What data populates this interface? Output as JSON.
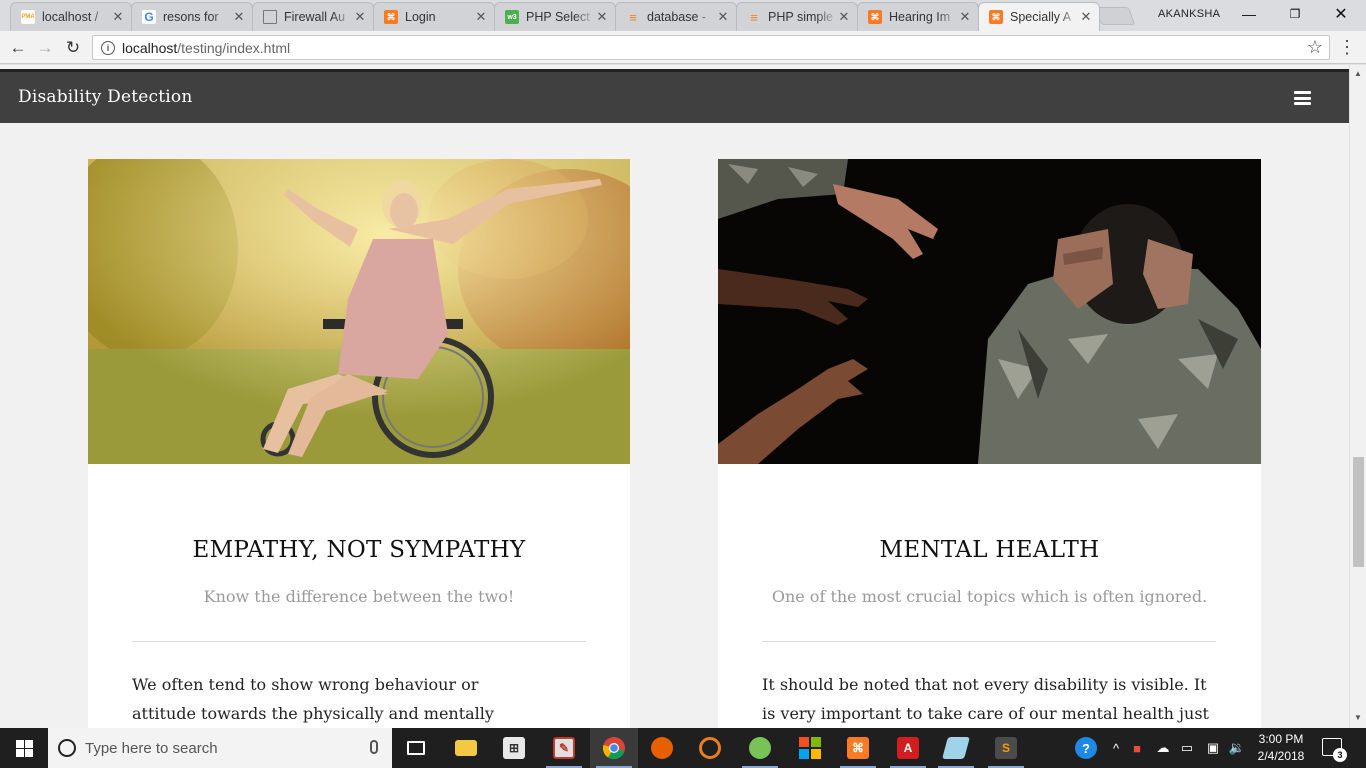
{
  "browser": {
    "tabs": [
      {
        "title": "localhost /",
        "favicon_color": "#f6a21e",
        "favicon_text": "PMA"
      },
      {
        "title": "resons for",
        "favicon_color": "#ffffff",
        "favicon_text": "G"
      },
      {
        "title": "Firewall Au",
        "favicon_color": "#ffffff",
        "favicon_text": ""
      },
      {
        "title": "Login",
        "favicon_color": "#fb7a24",
        "favicon_text": ""
      },
      {
        "title": "PHP Select",
        "favicon_color": "#4cb050",
        "favicon_text": "w3"
      },
      {
        "title": "database -",
        "favicon_color": "#f48024",
        "favicon_text": ""
      },
      {
        "title": "PHP simple",
        "favicon_color": "#f48024",
        "favicon_text": ""
      },
      {
        "title": "Hearing Im",
        "favicon_color": "#fb7a24",
        "favicon_text": ""
      },
      {
        "title": "Specially A",
        "favicon_color": "#fb7a24",
        "favicon_text": ""
      }
    ],
    "profile_name": "AKANKSHA",
    "url_host": "localhost",
    "url_path": "/testing/index.html"
  },
  "site": {
    "brand": "Disability Detection",
    "cards": [
      {
        "title": "EMPATHY, NOT SYMPATHY",
        "subtitle": "Know the difference between the two!",
        "body": "We often tend to show wrong behaviour or attitude towards the physically and mentally challenged"
      },
      {
        "title": "MENTAL HEALTH",
        "subtitle": "One of the most crucial topics which is often ignored.",
        "body": "It should be noted that not every disability is visible. It is very important to take care of our mental health just like"
      }
    ]
  },
  "taskbar": {
    "search_placeholder": "Type here to search",
    "time": "3:00 PM",
    "date": "2/4/2018",
    "notification_count": "3"
  }
}
